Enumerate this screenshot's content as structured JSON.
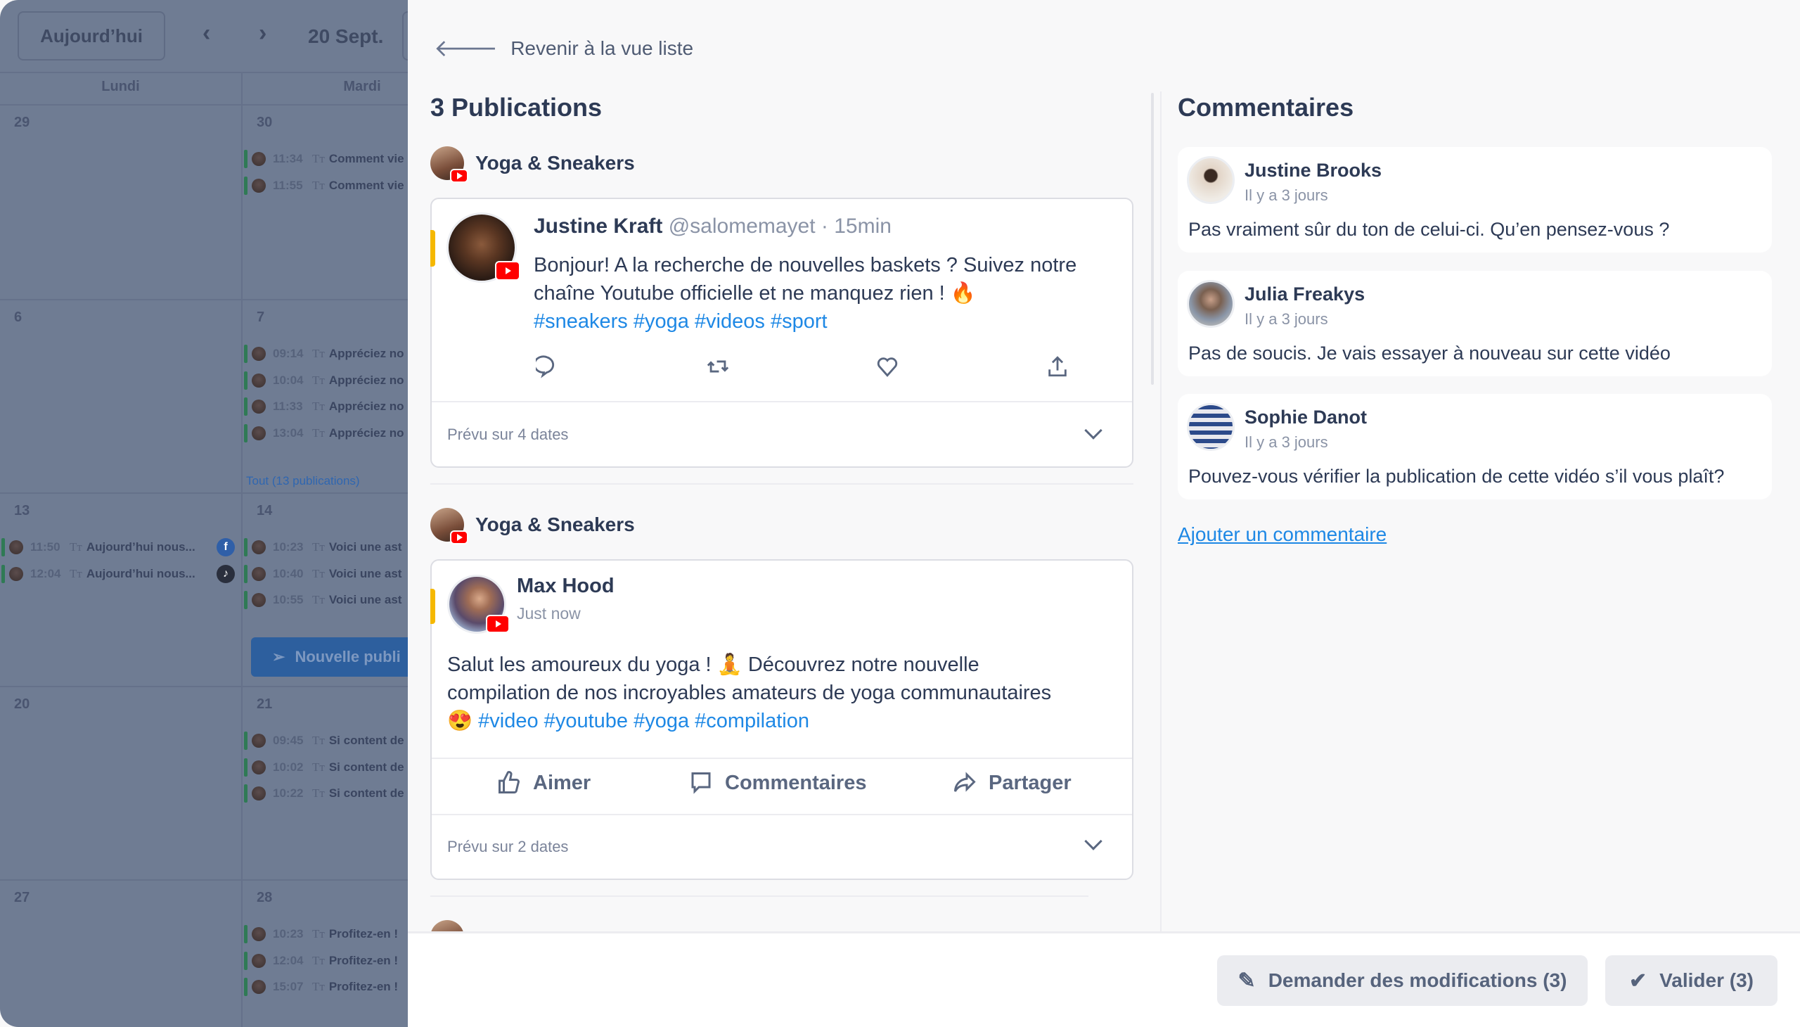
{
  "calendar": {
    "today_label": "Aujourd’hui",
    "prev_icon": "chevron-left-icon",
    "next_icon": "chevron-right-icon",
    "current_date": "20 Sept.",
    "weekdays": [
      "Lundi",
      "Mardi"
    ],
    "weeks": [
      {
        "days": [
          "29",
          "30"
        ]
      },
      {
        "days": [
          "6",
          "7"
        ]
      },
      {
        "days": [
          "13",
          "14"
        ]
      },
      {
        "days": [
          "20",
          "21"
        ]
      },
      {
        "days": [
          "27",
          "28"
        ]
      }
    ],
    "events": [
      {
        "week": 0,
        "col": 1,
        "time": "11:34",
        "title": "Comment vie"
      },
      {
        "week": 0,
        "col": 1,
        "time": "11:55",
        "title": "Comment vie"
      },
      {
        "week": 1,
        "col": 1,
        "time": "09:14",
        "title": "Appréciez no"
      },
      {
        "week": 1,
        "col": 1,
        "time": "10:04",
        "title": "Appréciez no"
      },
      {
        "week": 1,
        "col": 1,
        "time": "11:33",
        "title": "Appréciez no"
      },
      {
        "week": 1,
        "col": 1,
        "time": "13:04",
        "title": "Appréciez no"
      },
      {
        "week": 2,
        "col": 0,
        "time": "11:50",
        "title": "Aujourd’hui nous...",
        "network": "facebook"
      },
      {
        "week": 2,
        "col": 0,
        "time": "12:04",
        "title": "Aujourd’hui nous...",
        "network": "tiktok"
      },
      {
        "week": 2,
        "col": 1,
        "time": "10:23",
        "title": "Voici une ast"
      },
      {
        "week": 2,
        "col": 1,
        "time": "10:40",
        "title": "Voici une ast"
      },
      {
        "week": 2,
        "col": 1,
        "time": "10:55",
        "title": "Voici une ast"
      },
      {
        "week": 3,
        "col": 1,
        "time": "09:45",
        "title": "Si content de"
      },
      {
        "week": 3,
        "col": 1,
        "time": "10:02",
        "title": "Si content de"
      },
      {
        "week": 3,
        "col": 1,
        "time": "10:22",
        "title": "Si content de"
      },
      {
        "week": 4,
        "col": 1,
        "time": "10:23",
        "title": "Profitez-en !"
      },
      {
        "week": 4,
        "col": 1,
        "time": "12:04",
        "title": "Profitez-en !"
      },
      {
        "week": 4,
        "col": 1,
        "time": "15:07",
        "title": "Profitez-en !"
      }
    ],
    "show_all_link": "Tout (13 publications)",
    "new_post_button": "Nouvelle publi"
  },
  "panel": {
    "back_label": "Revenir à la vue liste",
    "title": "3 Publications",
    "publications": [
      {
        "account": "Yoga & Sneakers",
        "network": "youtube",
        "author": "Justine Kraft",
        "handle": "@salomemayet · 15min",
        "text_lines": [
          "Bonjour! A la recherche de nouvelles baskets ? Suivez notre",
          "chaîne Youtube officielle et ne manquez rien ! 🔥"
        ],
        "hashtags": "#sneakers #yoga #videos #sport",
        "actions": [
          "reply-icon",
          "retweet-icon",
          "heart-icon",
          "share-icon"
        ],
        "scheduled": "Prévu sur 4 dates"
      },
      {
        "account": "Yoga & Sneakers",
        "network": "youtube",
        "author": "Max Hood",
        "time": "Just now",
        "text_lines": [
          "Salut les amoureux du yoga ! 🧘 Découvrez notre nouvelle",
          "compilation de nos incroyables amateurs de yoga communautaires"
        ],
        "emoji": "😍",
        "hashtags": "#video #youtube #yoga #compilation",
        "actions": [
          "Aimer",
          "Commentaires",
          "Partager"
        ],
        "scheduled": "Prévu sur 2 dates"
      }
    ],
    "comments_title": "Commentaires",
    "comments": [
      {
        "name": "Justine Brooks",
        "time": "Il y a 3 jours",
        "text": "Pas vraiment sûr du ton de celui-ci. Qu’en pensez-vous ?"
      },
      {
        "name": "Julia Freakys",
        "time": "Il y a 3 jours",
        "text": "Pas de soucis. Je vais essayer à nouveau sur cette vidéo"
      },
      {
        "name": "Sophie Danot",
        "time": "Il y a 3 jours",
        "text": "Pouvez-vous vérifier la publication de cette vidéo s’il vous plaît?"
      }
    ],
    "add_comment": "Ajouter un commentaire",
    "footer": {
      "request_changes": "Demander des modifications (3)",
      "validate": "Valider (3)"
    }
  },
  "colors": {
    "accent": "#f5b800",
    "link": "#1e88e5",
    "youtube": "#ff0000",
    "text": "#2d3a55"
  }
}
